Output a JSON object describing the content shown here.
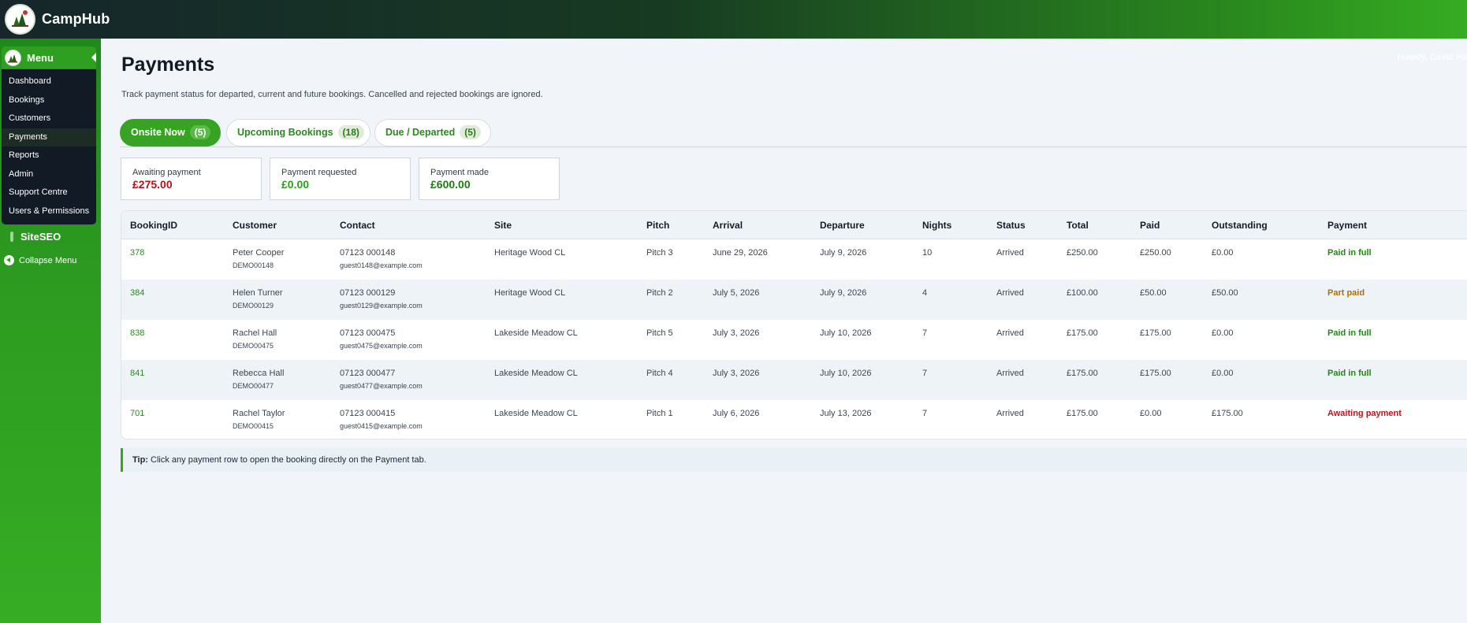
{
  "app": {
    "title": "CampHub",
    "howdy": "Howdy, David Ha"
  },
  "sidebar": {
    "menu_title": "Menu",
    "items": [
      {
        "label": "Dashboard"
      },
      {
        "label": "Bookings"
      },
      {
        "label": "Customers"
      },
      {
        "label": "Payments",
        "active": true
      },
      {
        "label": "Reports"
      },
      {
        "label": "Admin"
      },
      {
        "label": "Support Centre"
      },
      {
        "label": "Users & Permissions"
      }
    ],
    "siteseo": "SiteSEO",
    "collapse": "Collapse Menu"
  },
  "page": {
    "title": "Payments",
    "description": "Track payment status for departed, current and future bookings. Cancelled and rejected bookings are ignored."
  },
  "tabs": [
    {
      "label": "Onsite Now",
      "count": "(5)",
      "active": true
    },
    {
      "label": "Upcoming Bookings",
      "count": "(18)"
    },
    {
      "label": "Due / Departed",
      "count": "(5)"
    }
  ],
  "summary": [
    {
      "label": "Awaiting payment",
      "value": "£275.00",
      "color": "#b4121b"
    },
    {
      "label": "Payment requested",
      "value": "£0.00",
      "color": "#2e9a1f"
    },
    {
      "label": "Payment made",
      "value": "£600.00",
      "color": "#1f7a14"
    }
  ],
  "table": {
    "headers": [
      "BookingID",
      "Customer",
      "Contact",
      "Site",
      "Pitch",
      "Arrival",
      "Departure",
      "Nights",
      "Status",
      "Total",
      "Paid",
      "Outstanding",
      "Payment"
    ],
    "rows": [
      {
        "id": "378",
        "name": "Peter Cooper",
        "ref": "DEMO00148",
        "phone": "07123 000148",
        "email": "guest0148@example.com",
        "site": "Heritage Wood CL",
        "pitch": "Pitch 3",
        "arrival": "June 29, 2026",
        "departure": "July 9, 2026",
        "nights": "10",
        "status": "Arrived",
        "total": "£250.00",
        "paid": "£250.00",
        "outstanding": "£0.00",
        "payment": "Paid in full",
        "payment_color": "#1f8a14"
      },
      {
        "id": "384",
        "name": "Helen Turner",
        "ref": "DEMO00129",
        "phone": "07123 000129",
        "email": "guest0129@example.com",
        "site": "Heritage Wood CL",
        "pitch": "Pitch 2",
        "arrival": "July 5, 2026",
        "departure": "July 9, 2026",
        "nights": "4",
        "status": "Arrived",
        "total": "£100.00",
        "paid": "£50.00",
        "outstanding": "£50.00",
        "payment": "Part paid",
        "payment_color": "#a8700f"
      },
      {
        "id": "838",
        "name": "Rachel Hall",
        "ref": "DEMO00475",
        "phone": "07123 000475",
        "email": "guest0475@example.com",
        "site": "Lakeside Meadow CL",
        "pitch": "Pitch 5",
        "arrival": "July 3, 2026",
        "departure": "July 10, 2026",
        "nights": "7",
        "status": "Arrived",
        "total": "£175.00",
        "paid": "£175.00",
        "outstanding": "£0.00",
        "payment": "Paid in full",
        "payment_color": "#1f8a14"
      },
      {
        "id": "841",
        "name": "Rebecca Hall",
        "ref": "DEMO00477",
        "phone": "07123 000477",
        "email": "guest0477@example.com",
        "site": "Lakeside Meadow CL",
        "pitch": "Pitch 4",
        "arrival": "July 3, 2026",
        "departure": "July 10, 2026",
        "nights": "7",
        "status": "Arrived",
        "total": "£175.00",
        "paid": "£175.00",
        "outstanding": "£0.00",
        "payment": "Paid in full",
        "payment_color": "#1f8a14"
      },
      {
        "id": "701",
        "name": "Rachel Taylor",
        "ref": "DEMO00415",
        "phone": "07123 000415",
        "email": "guest0415@example.com",
        "site": "Lakeside Meadow CL",
        "pitch": "Pitch 1",
        "arrival": "July 6, 2026",
        "departure": "July 13, 2026",
        "nights": "7",
        "status": "Arrived",
        "total": "£175.00",
        "paid": "£0.00",
        "outstanding": "£175.00",
        "payment": "Awaiting payment",
        "payment_color": "#c0121e"
      }
    ]
  },
  "tip": {
    "label": "Tip:",
    "text": "Click any payment row to open the booking directly on the Payment tab."
  },
  "colors": {
    "brand_green": "#36a323",
    "sidebar_dark": "#111a25"
  }
}
